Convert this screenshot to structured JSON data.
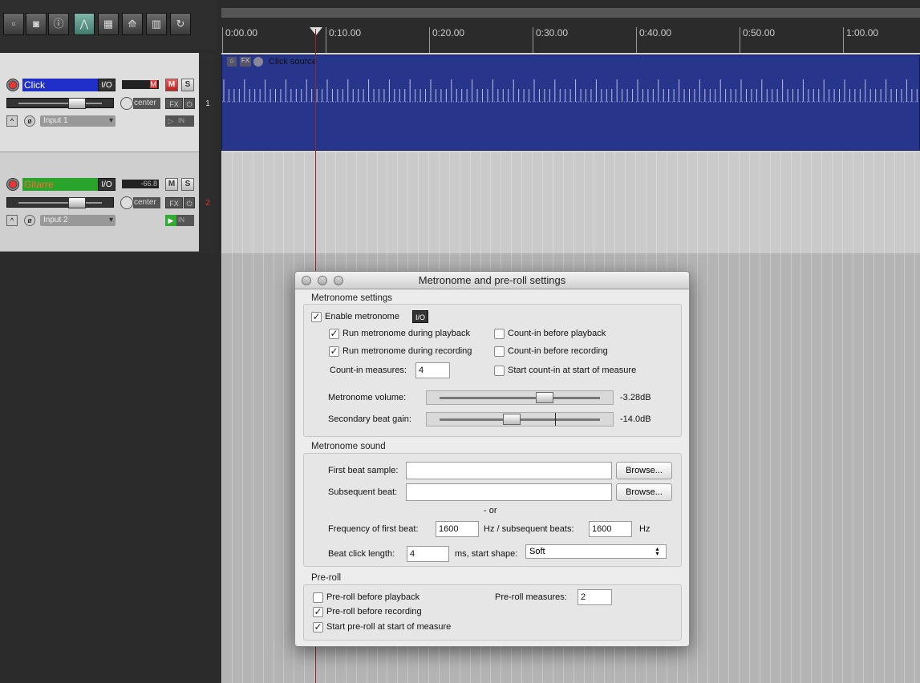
{
  "toolbar": {
    "buttons": [
      {
        "name": "new-project-icon",
        "glyph": "📄"
      },
      {
        "name": "save-project-icon",
        "glyph": "💾"
      },
      {
        "name": "project-settings-icon",
        "glyph": "ℹ"
      },
      {
        "name": "auto-crossfade-icon",
        "glyph": "⋀"
      },
      {
        "name": "ripple-edit-icon",
        "glyph": "▦"
      },
      {
        "name": "envelope-points-icon",
        "glyph": "⟰"
      },
      {
        "name": "snap-grid-icon",
        "glyph": "▥"
      },
      {
        "name": "loop-icon",
        "glyph": "↻"
      }
    ]
  },
  "tracks": [
    {
      "number": "1",
      "name": "Click",
      "io": "I/O",
      "meter": "M",
      "mute": "M",
      "solo": "S",
      "pan": "center",
      "fx": "FX",
      "power": "⏻",
      "input": "Input 1",
      "env": "^",
      "phase": "ø",
      "in": "IN"
    },
    {
      "number": "2",
      "name": "Gitarre",
      "io": "I/O",
      "meter": "-66.8",
      "mute": "M",
      "solo": "S",
      "pan": "center",
      "fx": "FX",
      "power": "⏻",
      "input": "Input 2",
      "env": "^",
      "phase": "ø",
      "in": "IN"
    }
  ],
  "ruler": {
    "ticks": [
      "0:00.00",
      "0:10.00",
      "0:20.00",
      "0:30.00",
      "0:40.00",
      "0:50.00",
      "1:00.00"
    ]
  },
  "item": {
    "label": "Click source"
  },
  "colors": {
    "track1_name_bg": "#1f2fc8",
    "track2_name_bg": "#2aa42a",
    "item_bg": "#27368a",
    "mute_on": "#d63a3a"
  },
  "dialog": {
    "title": "Metronome and pre-roll settings",
    "metronome_settings": {
      "heading": "Metronome settings",
      "enable": "Enable metronome",
      "io": "I/O",
      "run_playback": "Run metronome during playback",
      "run_recording": "Run metronome during recording",
      "countin_playback": "Count-in before playback",
      "countin_recording": "Count-in before recording",
      "countin_measures_label": "Count-in measures:",
      "countin_measures_value": "4",
      "start_countin": "Start count-in at start of measure",
      "volume_label": "Metronome volume:",
      "volume_value": "-3.28dB",
      "secondary_label": "Secondary beat gain:",
      "secondary_value": "-14.0dB"
    },
    "metronome_sound": {
      "heading": "Metronome sound",
      "first_beat_label": "First beat sample:",
      "first_beat_value": "",
      "subsequent_label": "Subsequent beat:",
      "subsequent_value": "",
      "browse": "Browse...",
      "or": "- or",
      "freq_first_label": "Frequency of first beat:",
      "freq_first_value": "1600",
      "hz_subsequent_label": "Hz / subsequent beats:",
      "freq_subsequent_value": "1600",
      "hz": "Hz",
      "click_length_label": "Beat click length:",
      "click_length_value": "4",
      "start_shape_label": "ms, start shape:",
      "start_shape_value": "Soft"
    },
    "preroll": {
      "heading": "Pre-roll",
      "before_playback": "Pre-roll before playback",
      "before_recording": "Pre-roll before recording",
      "start_at_measure": "Start pre-roll at start of measure",
      "measures_label": "Pre-roll measures:",
      "measures_value": "2"
    }
  }
}
